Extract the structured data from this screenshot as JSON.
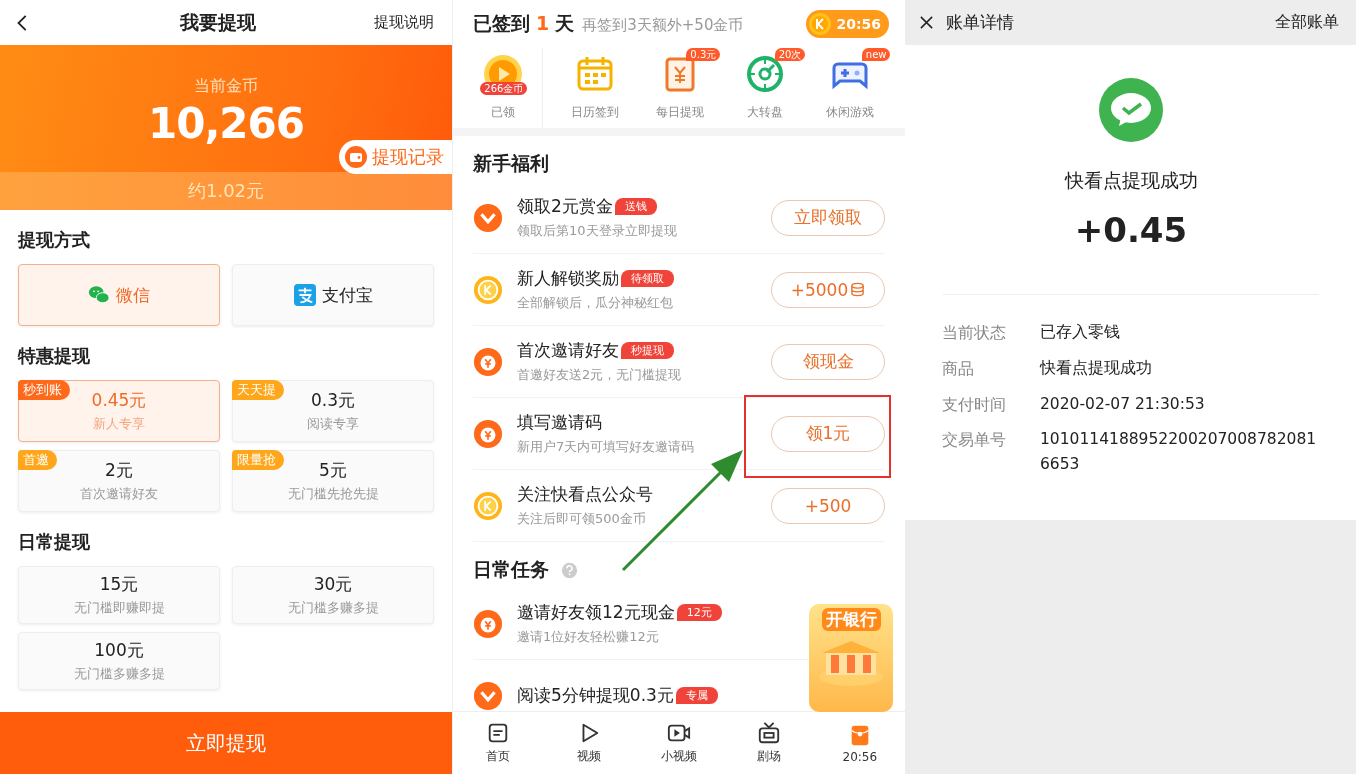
{
  "left": {
    "header": {
      "title": "我要提现",
      "action": "提现说明"
    },
    "balance": {
      "label": "当前金币",
      "coins": "10,266",
      "record_button": "提现记录",
      "approx": "约1.02元"
    },
    "methods_title": "提现方式",
    "methods": [
      {
        "label": "微信",
        "kind": "wechat",
        "selected": true
      },
      {
        "label": "支付宝",
        "kind": "alipay",
        "selected": false
      }
    ],
    "special_title": "特惠提现",
    "special": [
      {
        "tag": "秒到账",
        "amount": "0.45元",
        "note": "新人专享",
        "selected": true
      },
      {
        "tag": "天天提",
        "amount": "0.3元",
        "note": "阅读专享",
        "selected": false
      },
      {
        "tag": "首邀",
        "amount": "2元",
        "note": "首次邀请好友",
        "selected": false
      },
      {
        "tag": "限量抢",
        "amount": "5元",
        "note": "无门槛先抢先提",
        "selected": false
      }
    ],
    "daily_title": "日常提现",
    "daily": [
      {
        "amount": "15元",
        "note": "无门槛即赚即提",
        "selected": false
      },
      {
        "amount": "30元",
        "note": "无门槛多赚多提",
        "selected": false
      },
      {
        "amount": "100元",
        "note": "无门槛多赚多提",
        "selected": false
      }
    ],
    "submit": "立即提现"
  },
  "middle": {
    "checkin": {
      "prefix": "已签到",
      "days": "1",
      "suffix": "天",
      "hint": "再签到3天额外+50金币",
      "timer": "20:56"
    },
    "shortcuts": [
      {
        "kind": "play",
        "label": "已领",
        "badge": "266金币"
      },
      {
        "kind": "calendar",
        "label": "日历签到"
      },
      {
        "kind": "receipt",
        "label": "每日提现",
        "badge": "0.3元"
      },
      {
        "kind": "wheel",
        "label": "大转盘",
        "badge": "20次"
      },
      {
        "kind": "gamepad",
        "label": "休闲游戏",
        "badge": "new"
      }
    ],
    "sections": [
      {
        "title": "新手福利",
        "help": false,
        "tasks": [
          {
            "kind": "chevron",
            "title": "领取2元赏金",
            "tag": "送钱",
            "subtitle": "领取后第10天登录立即提现",
            "button": "立即领取",
            "coins": false,
            "highlighted": false
          },
          {
            "kind": "coin",
            "title": "新人解锁奖励",
            "tag": "待领取",
            "subtitle": "全部解锁后，瓜分神秘红包",
            "button": "+5000",
            "coins": true,
            "highlighted": false
          },
          {
            "kind": "yen",
            "title": "首次邀请好友",
            "tag": "秒提现",
            "subtitle": "首邀好友送2元，无门槛提现",
            "button": "领现金",
            "coins": false,
            "highlighted": false
          },
          {
            "kind": "yen",
            "title": "填写邀请码",
            "subtitle": "新用户7天内可填写好友邀请码",
            "button": "领1元",
            "coins": false,
            "highlighted": true
          },
          {
            "kind": "coin",
            "title": "关注快看点公众号",
            "subtitle": "关注后即可领500金币",
            "button": "+500",
            "coins": false,
            "highlighted": false
          }
        ]
      },
      {
        "title": "日常任务",
        "help": true,
        "tasks": [
          {
            "kind": "yen",
            "title": "邀请好友领12元现金",
            "tag": "12元",
            "subtitle": "邀请1位好友轻松赚12元"
          },
          {
            "kind": "chevron",
            "title": "阅读5分钟提现0.3元",
            "tag": "专属"
          }
        ]
      }
    ],
    "promo": {
      "title": "开银行"
    },
    "annotations": [
      {
        "kind": "arrow"
      }
    ],
    "nav": [
      {
        "kind": "home",
        "label": "首页",
        "selected": false
      },
      {
        "kind": "video",
        "label": "视频",
        "selected": false
      },
      {
        "kind": "shortvideo",
        "label": "小视频",
        "selected": false
      },
      {
        "kind": "tv",
        "label": "剧场",
        "selected": false
      },
      {
        "kind": "redpacket",
        "label": "20:56",
        "selected": true
      }
    ]
  },
  "right": {
    "header": {
      "title": "账单详情",
      "action": "全部账单"
    },
    "merchant": "快看点提现成功",
    "amount": "+0.45",
    "details": [
      {
        "label": "当前状态",
        "value": "已存入零钱"
      },
      {
        "label": "商品",
        "value": "快看点提现成功"
      },
      {
        "label": "支付时间",
        "value": "2020-02-07 21:30:53"
      },
      {
        "label": "交易单号",
        "value": "10101141889522002070087820816653"
      }
    ]
  }
}
